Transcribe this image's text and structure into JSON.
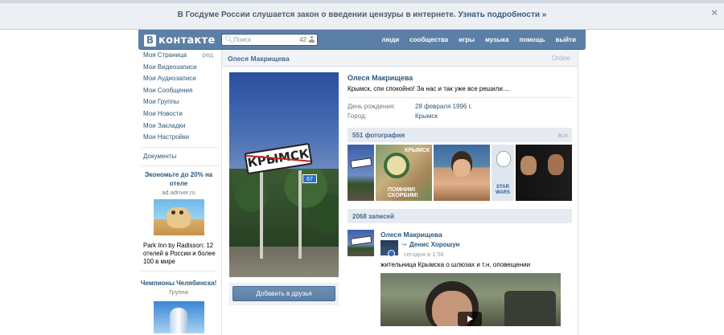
{
  "notice": {
    "text": "В Госдуме России слушается закон о введении цензуры в интернете.",
    "link": "Узнать подробности »",
    "close": "×"
  },
  "header": {
    "logo_letter": "В",
    "logo_text": "контакте",
    "search_placeholder": "Поиск",
    "search_count": "42",
    "nav": [
      "люди",
      "сообщества",
      "игры",
      "музыка",
      "помощь",
      "выйти"
    ]
  },
  "sidebar": {
    "items": [
      "Моя Страница",
      "Мои Видеозаписи",
      "Мои Аудиозаписи",
      "Мои Сообщения",
      "Мои Группы",
      "Мои Новости",
      "Мои Закладки",
      "Мои Настройки"
    ],
    "edit_label": "ред.",
    "documents": "Документы",
    "ad": {
      "title": "Экономьте до 20% на отеле",
      "domain": "ad.adriver.ru",
      "text": "Park Inn by Radisson: 12 отелей в России и более 100 в мире"
    },
    "group": {
      "title": "Чемпионы Челябинска!",
      "type": "Группа"
    }
  },
  "profile": {
    "top_name": "Олеся Макрищева",
    "online": "Online",
    "name": "Олеся Макрищева",
    "status": "Крымск, спи спокойно! За нас и так уже все решили....",
    "birthday_label": "День рождения:",
    "birthday_value": "28 февраля 1996 г.",
    "city_label": "Город:",
    "city_value": "Крымск",
    "add_friend": "Добавить в друзья",
    "sign_text": "КРЫМСК",
    "sign_plate": "67"
  },
  "photos": {
    "header": "551 фотография",
    "all": "все",
    "ph2_top": "КРЫМСК",
    "ph2_bottom": "ПОМНИМ! СКОРБИМ!",
    "ph4_text": "STAR WARS"
  },
  "wall": {
    "header": "2068 записей",
    "post": {
      "author": "Олеся Макрищева",
      "repost_name": "Денис Хорошун",
      "repost_time": "сегодня в 1:56",
      "text": "жительница Крымска о шлюзах и т.н. оповещении"
    }
  }
}
